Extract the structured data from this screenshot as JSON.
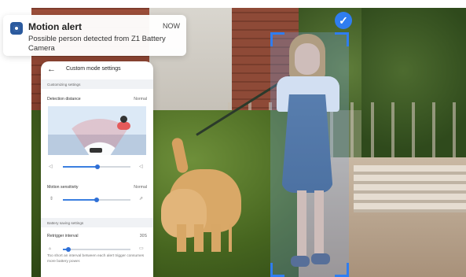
{
  "notification": {
    "title": "Motion alert",
    "time": "NOW",
    "body": "Possible person detected from Z1 Battery Camera",
    "icon": "camera-app-icon"
  },
  "settings": {
    "title": "Custom mode settings",
    "customizing_label": "Customizing settings",
    "detection_distance_label": "Detection distance",
    "detection_distance_value": "Normal",
    "detection_distance_level": 0.51,
    "motion_sensitivity_label": "Motion sensitivity",
    "motion_sensitivity_value": "Normal",
    "motion_sensitivity_level": 0.5,
    "battery_saving_label": "Battery saving settings",
    "retrigger_label": "Retrigger interval",
    "retrigger_value": "30S",
    "retrigger_level": 0.08,
    "note": "Too short an interval between each alert trigger consumes more battery power."
  },
  "colors": {
    "accent": "#2f7df0",
    "detection_fill": "#76a5eb"
  },
  "icons": {
    "back": "back-arrow-icon",
    "check": "check-icon",
    "volume_low": "speaker-low-icon",
    "volume_high": "speaker-high-icon"
  }
}
